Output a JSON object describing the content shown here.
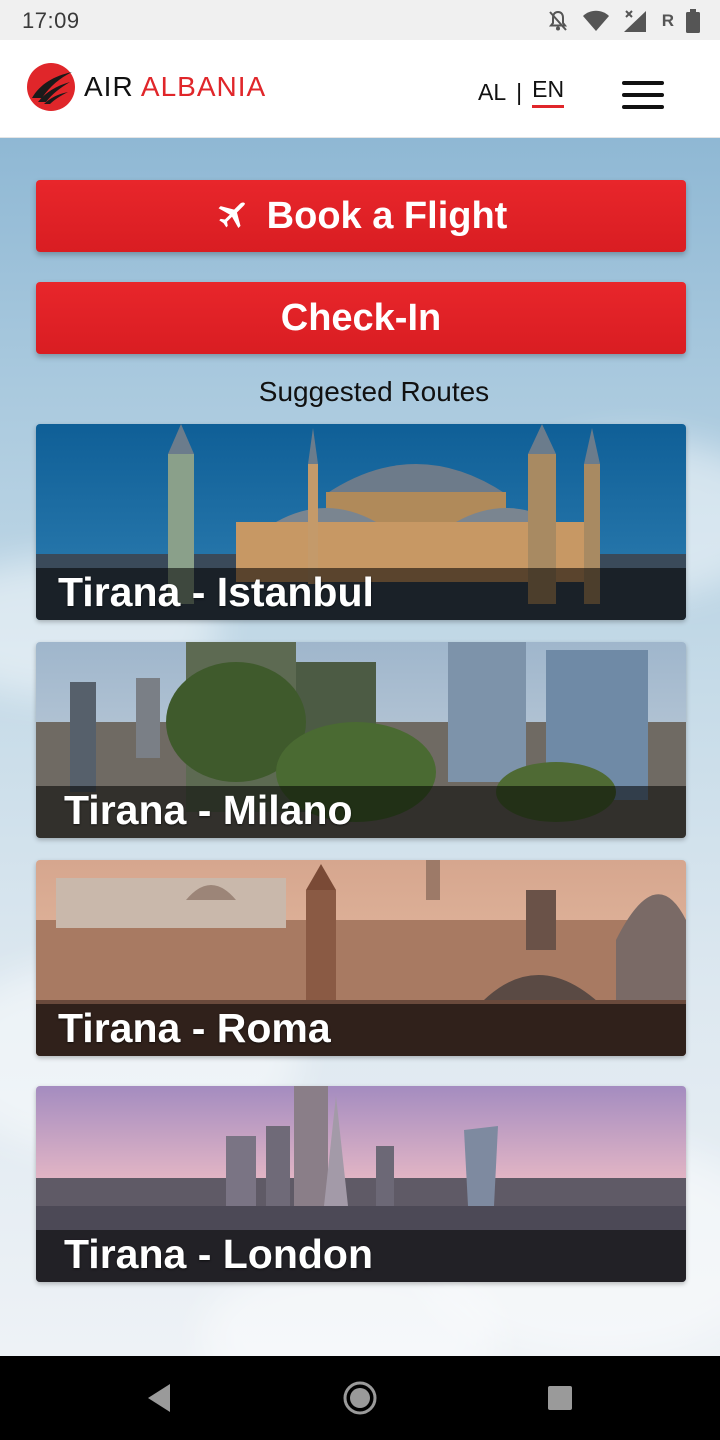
{
  "status_bar": {
    "time": "17:09",
    "icons": [
      "notifications-off-icon",
      "wifi-icon",
      "signal-icon",
      "battery-icon"
    ],
    "carrier_badge": "R"
  },
  "header": {
    "logo_air": "AIR",
    "logo_brand": "ALBANIA",
    "lang_al": "AL",
    "lang_sep": "|",
    "lang_en": "EN",
    "menu_icon": "hamburger-menu-icon"
  },
  "actions": {
    "book_label": "Book a Flight",
    "book_icon": "airplane-icon",
    "checkin_label": "Check-In"
  },
  "suggested": {
    "title": "Suggested Routes",
    "routes": [
      {
        "label": "Tirana - Istanbul"
      },
      {
        "label": "Tirana - Milano"
      },
      {
        "label": "Tirana - Roma"
      },
      {
        "label": "Tirana - London"
      }
    ]
  },
  "nav_bar": {
    "icons": [
      "back-icon",
      "home-icon",
      "recents-icon"
    ]
  },
  "colors": {
    "brand_red": "#e0262a",
    "button_red": "#e1222a",
    "header_bg": "#ffffff",
    "nav_bg": "#000000"
  }
}
